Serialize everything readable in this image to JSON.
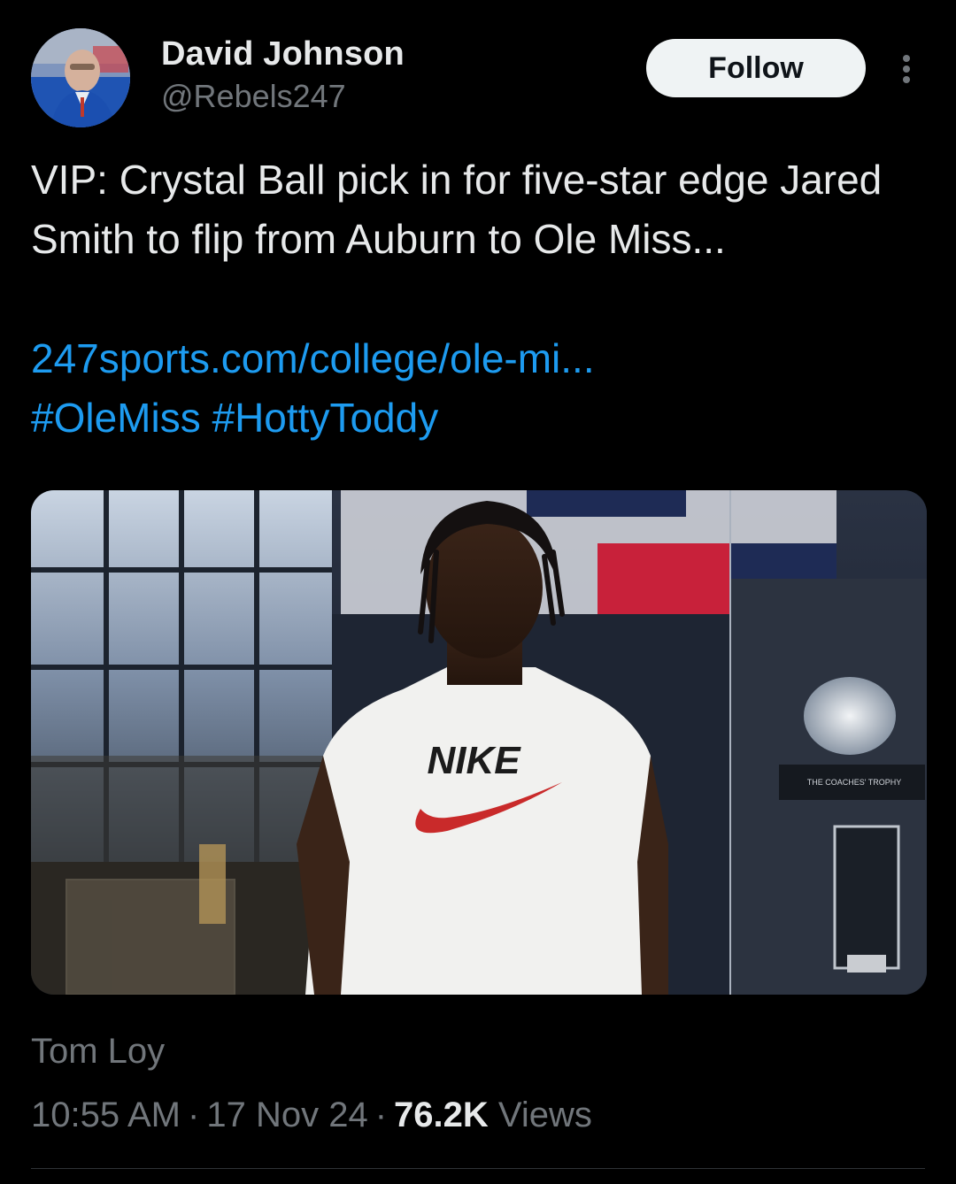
{
  "author": {
    "name": "David Johnson",
    "handle": "@Rebels247",
    "avatar_icon": "profile-photo"
  },
  "header": {
    "follow_label": "Follow",
    "more_icon": "more-vertical-icon"
  },
  "tweet": {
    "text": "VIP: Crystal Ball pick in for five-star edge Jared Smith to flip from Auburn to Ole Miss...",
    "link": "247sports.com/college/ole-mi...",
    "hashtags": [
      "#OleMiss",
      "#HottyToddy"
    ]
  },
  "media": {
    "shirt_text": "NIKE",
    "trophy_plaque": "THE COACHES' TROPHY"
  },
  "footer": {
    "photo_credit": "Tom Loy",
    "time": "10:55 AM",
    "date": "17 Nov 24",
    "views_count": "76.2K",
    "views_label": "Views"
  },
  "colors": {
    "background": "#000000",
    "text": "#e7e9ea",
    "muted": "#71767b",
    "link": "#1d9bf0",
    "button_bg": "#eff3f4"
  }
}
